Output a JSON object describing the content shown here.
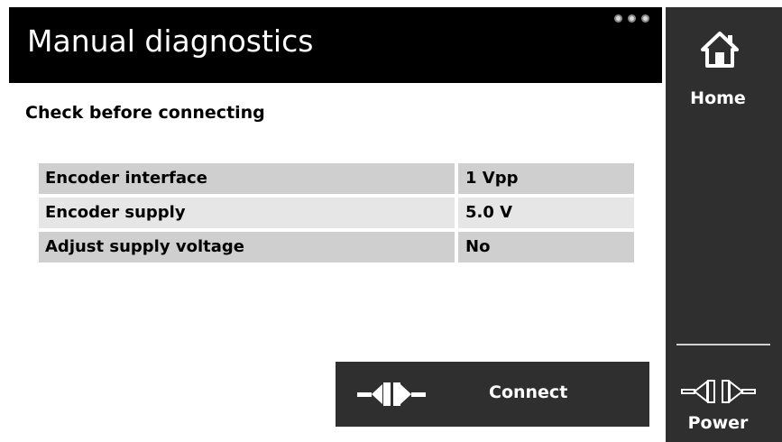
{
  "header": {
    "title": "Manual diagnostics",
    "indicator_icon": "three-dots-icon"
  },
  "main": {
    "subtitle": "Check before connecting",
    "rows": [
      {
        "label": "Encoder interface",
        "value": "1 Vpp"
      },
      {
        "label": "Encoder supply",
        "value": "5.0 V"
      },
      {
        "label": "Adjust supply voltage",
        "value": "No"
      }
    ],
    "connect_button": {
      "label": "Connect",
      "icon": "connector-icon"
    }
  },
  "sidebar": {
    "home": {
      "label": "Home",
      "icon": "home-icon"
    },
    "power": {
      "label": "Power",
      "icon": "power-connector-icon"
    }
  },
  "colors": {
    "header_bg": "#000000",
    "sidebar_bg": "#2f2f2f",
    "row_dark": "#cfcfcf",
    "row_light": "#e6e6e6"
  }
}
